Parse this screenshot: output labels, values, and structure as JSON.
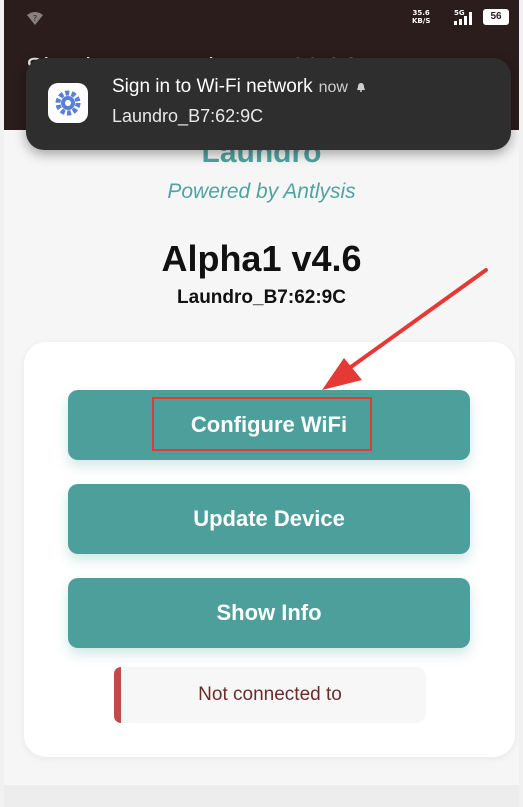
{
  "status_bar": {
    "net_speed_value": "35.6",
    "net_speed_unit": "KB/S",
    "network_type": "5G",
    "battery": "56"
  },
  "app_bar": {
    "title": "Sign in to Laundro_B7:62:9C"
  },
  "notification": {
    "title": "Sign in to Wi-Fi network",
    "time": "now",
    "subtitle": "Laundro_B7:62:9C"
  },
  "page": {
    "brand": "Laundro",
    "powered_by": "Powered by Antlysis",
    "device_name": "Alpha1 v4.6",
    "ssid": "Laundro_B7:62:9C"
  },
  "buttons": {
    "configure_wifi": "Configure WiFi",
    "update_device": "Update Device",
    "show_info": "Show Info"
  },
  "notice": {
    "text": "Not connected to"
  },
  "colors": {
    "accent": "#4d9f9b",
    "brand_text": "#4fa4a0",
    "highlight": "#e53935",
    "topbar": "#2a1d1c",
    "notification_bg": "#2e2e2e"
  }
}
